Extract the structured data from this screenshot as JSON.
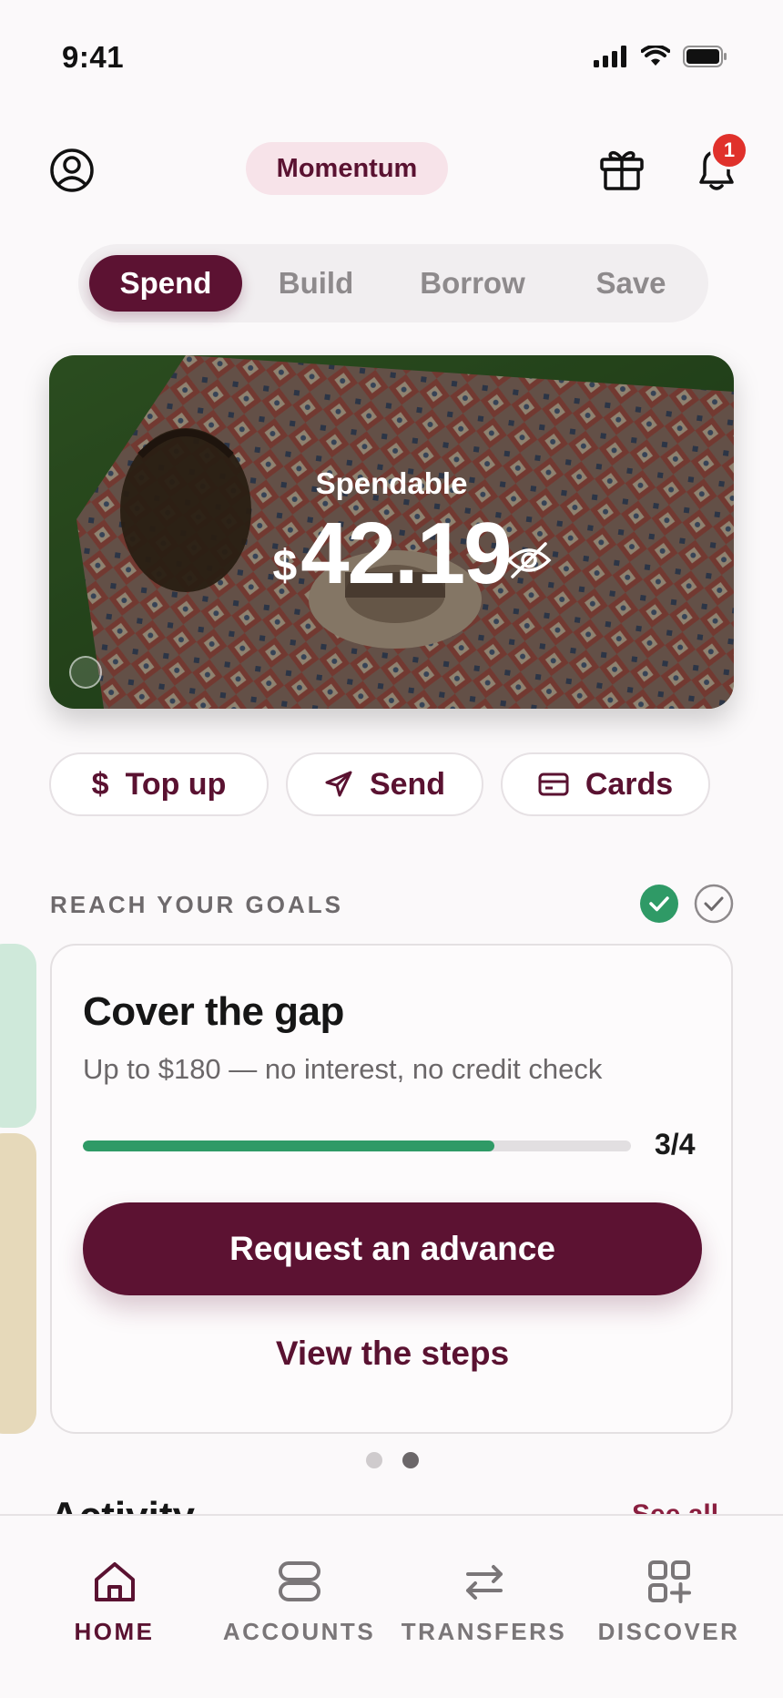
{
  "status_bar": {
    "time": "9:41",
    "icons": [
      "signal-icon",
      "wifi-icon",
      "battery-icon"
    ]
  },
  "header": {
    "plan_name": "Momentum",
    "notification_count": "1",
    "icons": [
      "profile-icon",
      "gift-icon",
      "bell-icon"
    ]
  },
  "tabs": [
    {
      "label": "Spend",
      "active": true
    },
    {
      "label": "Build",
      "active": false
    },
    {
      "label": "Borrow",
      "active": false
    },
    {
      "label": "Save",
      "active": false
    }
  ],
  "balance": {
    "label": "Spendable",
    "currency": "$",
    "amount": "42.19",
    "icon": "eye-off-icon"
  },
  "actions": [
    {
      "label": "Top up",
      "icon": "dollar-icon"
    },
    {
      "label": "Send",
      "icon": "send-icon"
    },
    {
      "label": "Cards",
      "icon": "card-icon"
    }
  ],
  "goals": {
    "section_label": "REACH YOUR GOALS",
    "card": {
      "title": "Cover the gap",
      "subtitle": "Up to $180 — no interest, no credit check",
      "progress_fraction": 0.75,
      "progress_text": "3/4",
      "primary_label": "Request an advance",
      "secondary_label": "View the steps"
    },
    "pager": {
      "count": 2,
      "active_index": 1
    }
  },
  "activity": {
    "heading": "Activity",
    "link": "See all"
  },
  "bottom_nav": [
    {
      "label": "HOME",
      "icon": "home-icon",
      "active": true
    },
    {
      "label": "ACCOUNTS",
      "icon": "accounts-icon",
      "active": false
    },
    {
      "label": "TRANSFERS",
      "icon": "transfers-icon",
      "active": false
    },
    {
      "label": "DISCOVER",
      "icon": "discover-icon",
      "active": false
    }
  ],
  "colors": {
    "brand": "#5c1232",
    "brand_pill_bg": "#f7e3e9",
    "success": "#2f9a66",
    "badge": "#e0312b"
  }
}
